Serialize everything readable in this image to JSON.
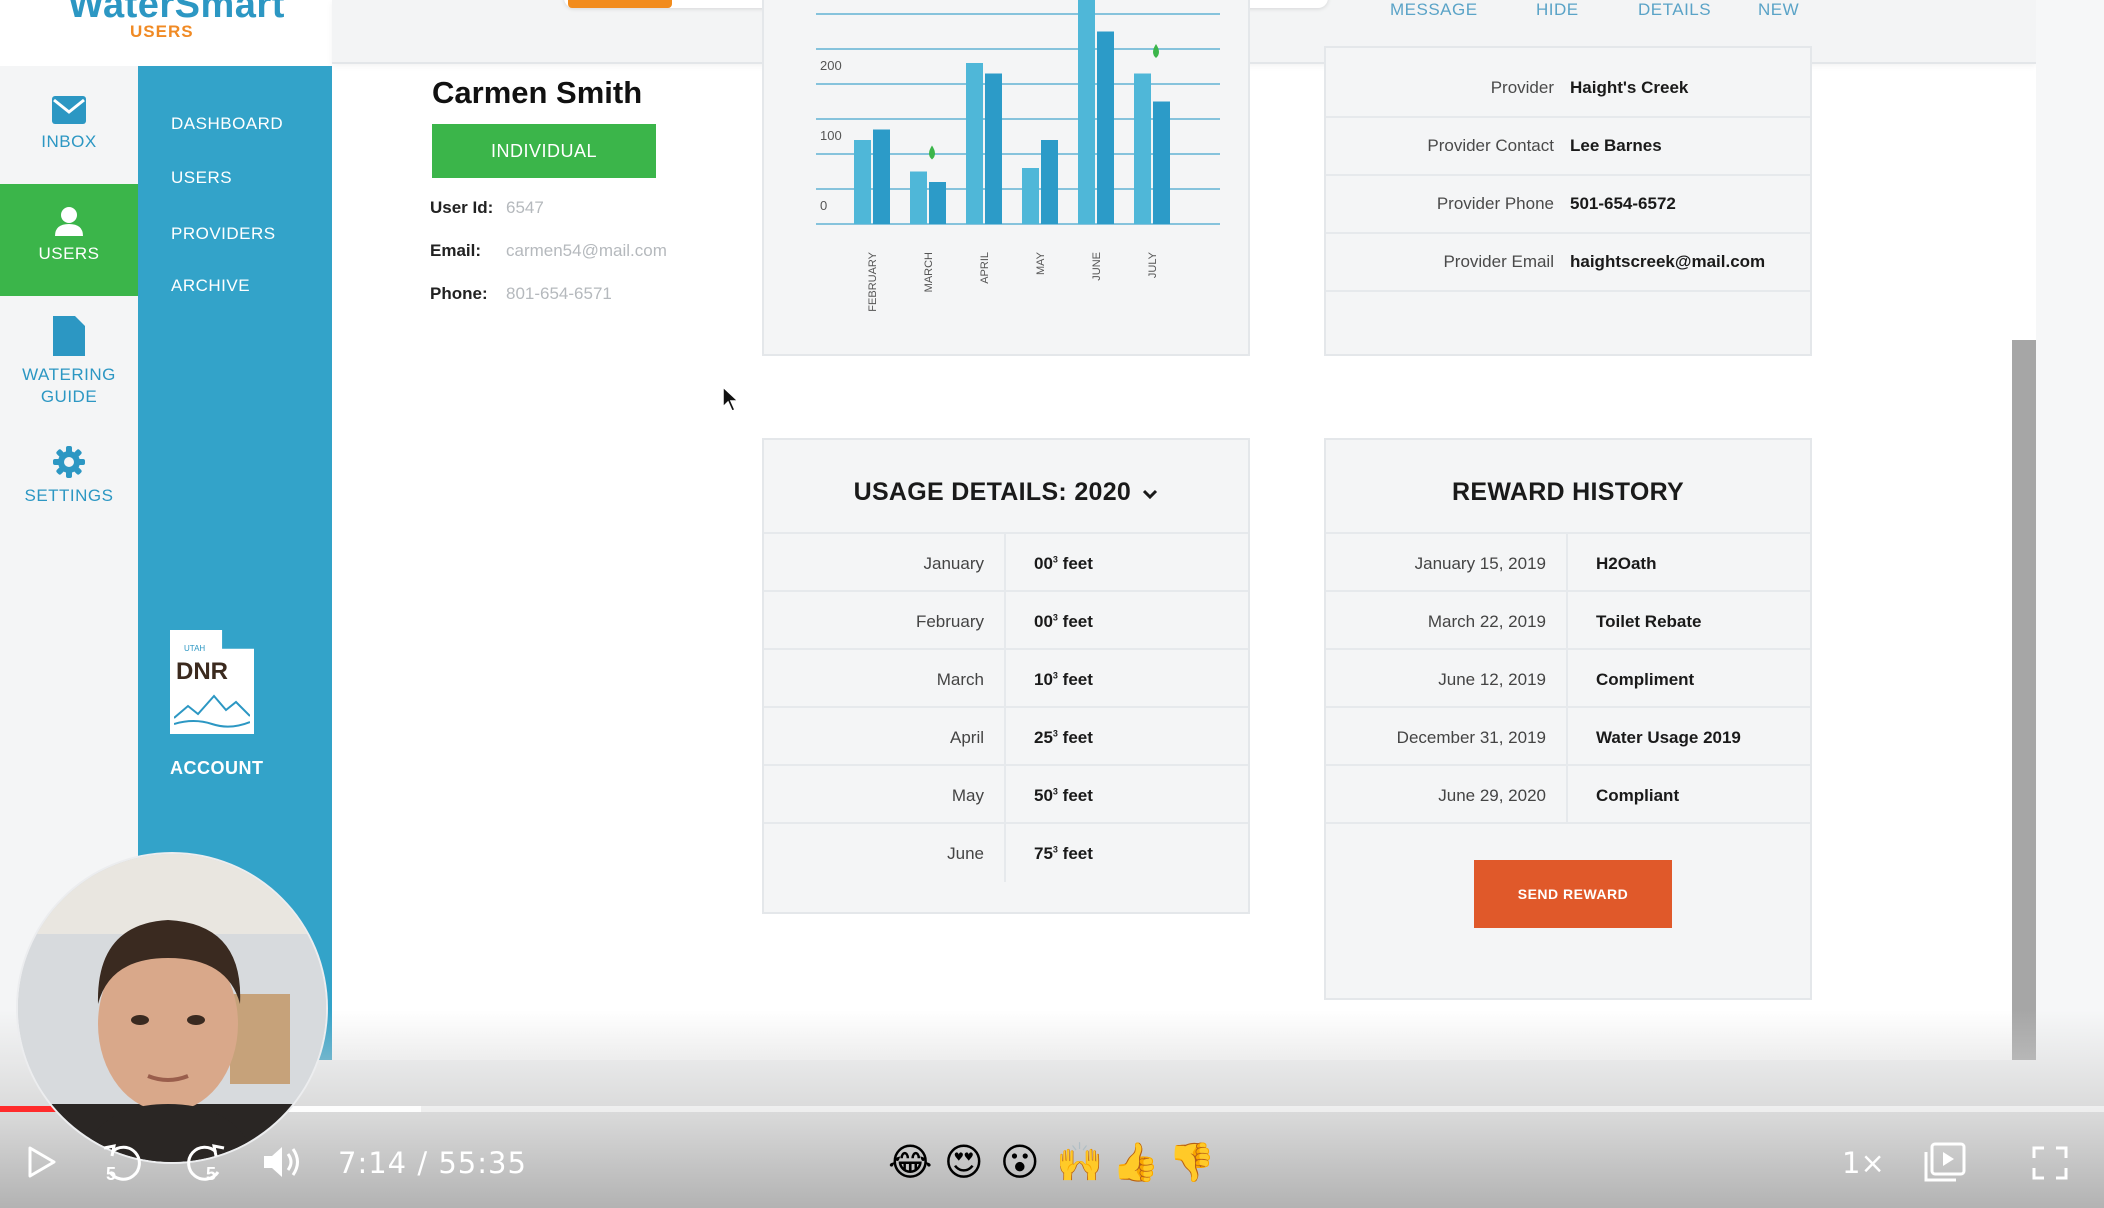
{
  "app": {
    "logo_text": "WaterSmart",
    "logo_subtitle": "USERS"
  },
  "topnav": [
    "MESSAGE",
    "HIDE",
    "DETAILS",
    "NEW"
  ],
  "rail": {
    "inbox": "INBOX",
    "users": "USERS",
    "watering_guide_1": "WATERING",
    "watering_guide_2": "GUIDE",
    "settings": "SETTINGS"
  },
  "submenu": [
    "DASHBOARD",
    "USERS",
    "PROVIDERS",
    "ARCHIVE"
  ],
  "account": {
    "logo_small": "UTAH",
    "logo_text": "DNR",
    "label": "ACCOUNT"
  },
  "user": {
    "name": "Carmen Smith",
    "type_badge": "INDIVIDUAL",
    "user_id_label": "User Id:",
    "user_id": "6547",
    "email_label": "Email:",
    "email": "carmen54@mail.com",
    "phone_label": "Phone:",
    "phone": "801-654-6571"
  },
  "chart_data": {
    "type": "bar",
    "categories": [
      "FEBRUARY",
      "MARCH",
      "APRIL",
      "MAY",
      "JUNE",
      "JULY"
    ],
    "series": [
      {
        "values": [
          120,
          75,
          230,
          80,
          330,
          215
        ]
      },
      {
        "values": [
          135,
          60,
          215,
          120,
          275,
          175
        ]
      }
    ],
    "ytick_labels": [
      "0",
      "100",
      "200"
    ],
    "ylim": [
      0,
      300
    ],
    "grid": true,
    "colors": [
      "#4fb7d8",
      "#2c9bc8"
    ],
    "drop_marker_color": "#3bb54a"
  },
  "provider": {
    "rows": [
      {
        "label": "Provider",
        "value": "Haight's Creek"
      },
      {
        "label": "Provider Contact",
        "value": "Lee Barnes"
      },
      {
        "label": "Provider Phone",
        "value": "501-654-6572"
      },
      {
        "label": "Provider Email",
        "value": "haightscreek@mail.com"
      }
    ]
  },
  "usage": {
    "title": "USAGE DETAILS:",
    "year": "2020",
    "unit": "feet",
    "superscript": "3",
    "rows": [
      {
        "month": "January",
        "value": "00"
      },
      {
        "month": "February",
        "value": "00"
      },
      {
        "month": "March",
        "value": "10"
      },
      {
        "month": "April",
        "value": "25"
      },
      {
        "month": "May",
        "value": "50"
      },
      {
        "month": "June",
        "value": "75"
      }
    ]
  },
  "rewards": {
    "title": "REWARD HISTORY",
    "rows": [
      {
        "date": "January 15, 2019",
        "reward": "H2Oath"
      },
      {
        "date": "March 22, 2019",
        "reward": "Toilet Rebate"
      },
      {
        "date": "June 12, 2019",
        "reward": "Compliment"
      },
      {
        "date": "December 31, 2019",
        "reward": "Water Usage 2019"
      },
      {
        "date": "June 29, 2020",
        "reward": "Compliant"
      }
    ],
    "send_button": "SEND REWARD"
  },
  "player": {
    "current_time": "7:14",
    "separator": "/",
    "duration": "55:35",
    "progress": 0.1301,
    "buffered": 0.2,
    "skip_back_seconds": "5",
    "skip_forward_seconds": "5",
    "speed": "1×",
    "reactions": [
      "😂",
      "😍",
      "😮",
      "🙌",
      "👍",
      "👎"
    ]
  },
  "colors": {
    "brand_blue": "#2c97c3",
    "submenu_blue": "#33a3c9",
    "active_green": "#3bb54a",
    "logo_orange": "#f08a24",
    "send_orange": "#e0592a",
    "progress_red": "#ff2b2b"
  }
}
